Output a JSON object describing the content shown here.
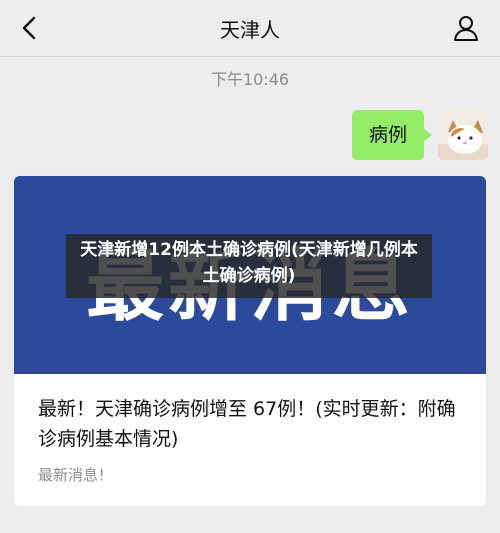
{
  "navbar": {
    "back_icon": "chevron-left-icon",
    "title": "天津人",
    "profile_icon": "person-icon"
  },
  "chat": {
    "timestamp": "下午10:46",
    "message": {
      "text": "病例",
      "bubble_color": "#95ec69",
      "avatar": "cat-avatar"
    }
  },
  "article_card": {
    "cover_text": "最新消息",
    "cover_color": "#2c4a9c",
    "overlay_title": "天津新增12例本土确诊病例(天津新增几例本土确诊病例)",
    "title": "最新！天津确诊病例增至 67例！(实时更新：附确诊病例基本情况)",
    "source": "最新消息！"
  }
}
